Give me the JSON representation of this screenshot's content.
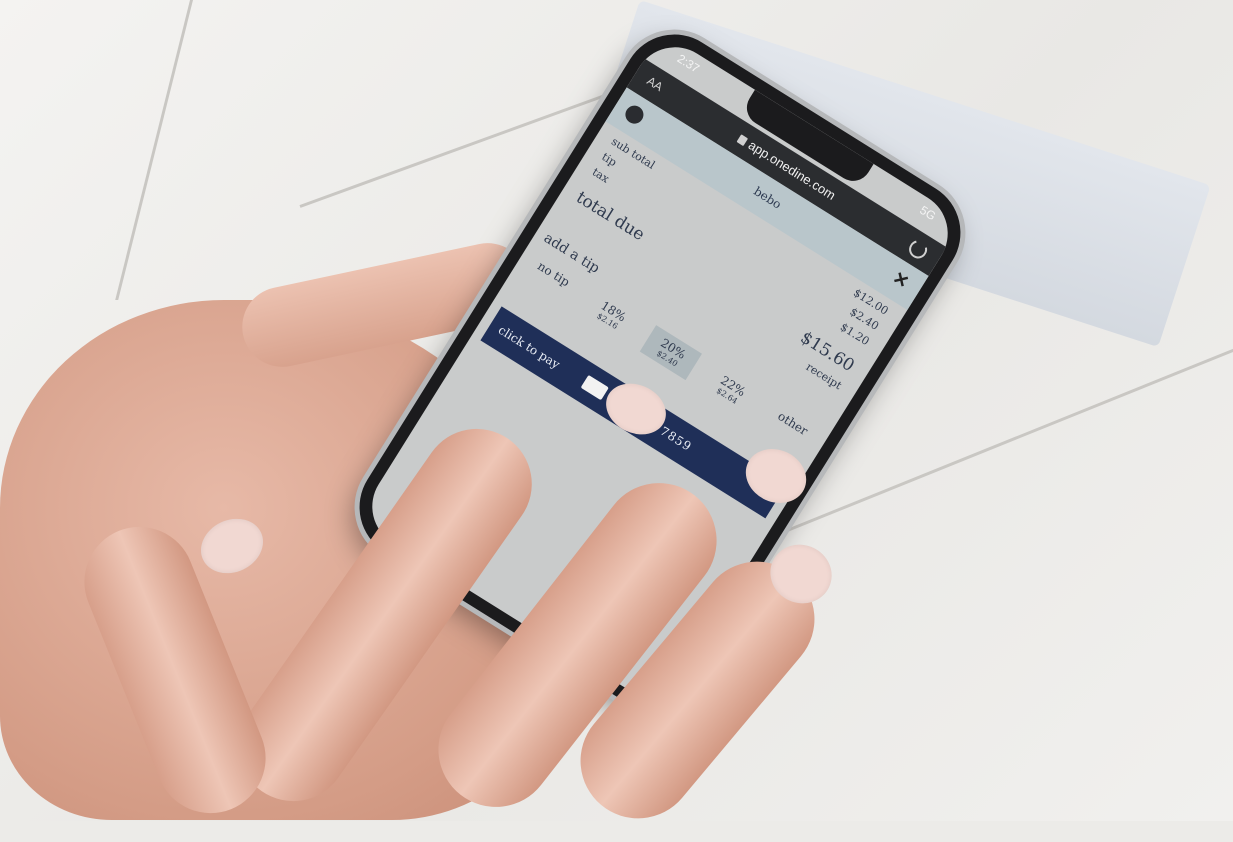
{
  "status": {
    "time": "2:37",
    "network": "5G"
  },
  "browser": {
    "font_size_control": "AA",
    "url": "app.onedine.com"
  },
  "header": {
    "logo": "bebo"
  },
  "receipt": {
    "subtotal_label": "sub total",
    "subtotal_value": "$12.00",
    "tip_label": "tip",
    "tip_value": "$2.40",
    "tax_label": "tax",
    "tax_value": "$1.20",
    "total_label": "total due",
    "total_value": "$15.60",
    "receipt_link": "receipt"
  },
  "tip": {
    "title": "add a tip",
    "options": [
      {
        "label": "no tip",
        "amount": ""
      },
      {
        "label": "18%",
        "amount": "$2.16"
      },
      {
        "label": "20%",
        "amount": "$2.40"
      },
      {
        "label": "22%",
        "amount": "$2.64"
      },
      {
        "label": "other",
        "amount": ""
      }
    ],
    "selected": "20%"
  },
  "payment": {
    "label": "click to pay",
    "card_brand": "VISA",
    "card_number": "XXXX - 7859"
  },
  "icons": [
    "profile-icon",
    "lock-icon",
    "reload-icon",
    "close-icon",
    "visa-icon"
  ]
}
